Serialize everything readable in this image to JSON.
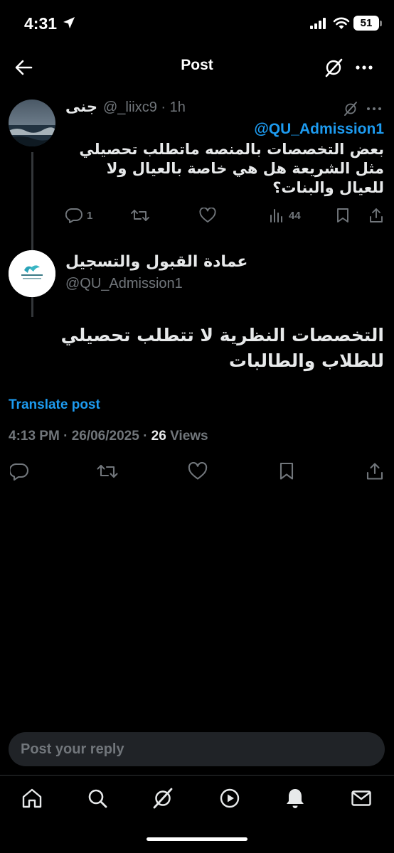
{
  "status_bar": {
    "time": "4:31",
    "battery": "51"
  },
  "header": {
    "title": "Post"
  },
  "parent_post": {
    "display_name": "جنى",
    "handle_time": "@_liixc9 · 1h",
    "mention": "@QU_Admission1",
    "text": "بعض التخصصات بالمنصه ماتطلب تحصيلي مثل الشريعة هل هي خاصة بالعيال ولا للعيال والبنات؟",
    "replies": "1",
    "views": "44"
  },
  "main_post": {
    "display_name": "عمادة القبول والتسجيل",
    "handle": "@QU_Admission1",
    "text": "التخصصات النظرية لا تتطلب تحصيلي للطلاب والطالبات",
    "translate_label": "Translate post",
    "timestamp": "4:13 PM · 26/06/2025 · ",
    "views_count": "26",
    "views_label": " Views"
  },
  "reply": {
    "placeholder": "Post your reply"
  },
  "colors": {
    "accent": "#1d9bf0",
    "muted": "#71767b",
    "text": "#e7e9ea",
    "background": "#000000"
  },
  "icons": {
    "header": [
      "back-arrow-icon",
      "grok-icon",
      "more-icon"
    ],
    "nav": [
      "home-icon",
      "search-icon",
      "grok-icon",
      "video-icon",
      "notifications-icon",
      "messages-icon"
    ]
  }
}
